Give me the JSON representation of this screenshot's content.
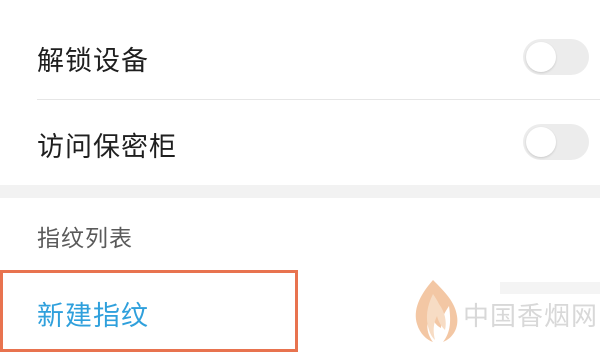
{
  "settings": {
    "items": [
      {
        "label": "解锁设备",
        "toggle_on": false
      },
      {
        "label": "访问保密柜",
        "toggle_on": false
      }
    ]
  },
  "fingerprints": {
    "section_title": "指纹列表",
    "add_label": "新建指纹"
  },
  "watermark": {
    "text": "中国香烟网"
  },
  "colors": {
    "accent_link": "#2fa0dc",
    "highlight_border": "#e8734f",
    "toggle_off_track": "#ececec",
    "watermark_logo": "#f0b48a"
  }
}
